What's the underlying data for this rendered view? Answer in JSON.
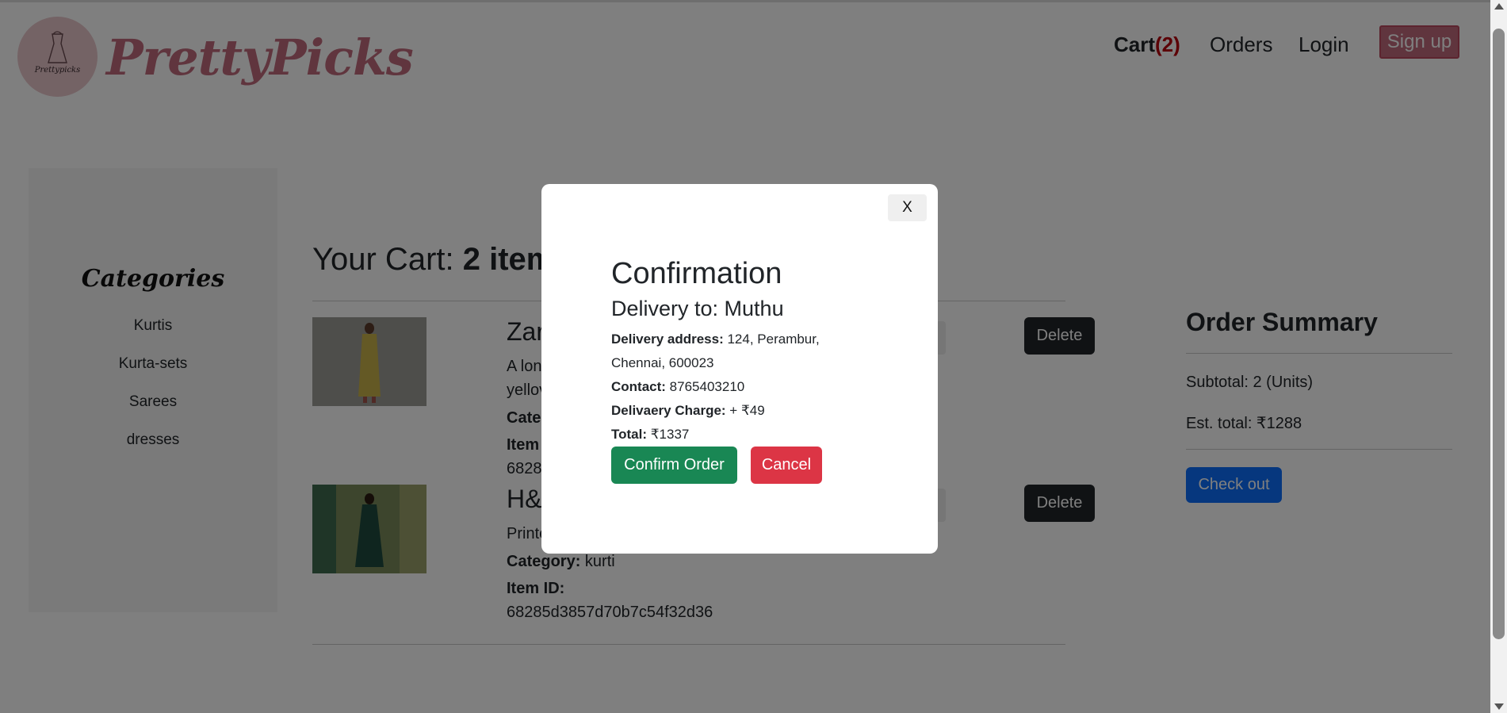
{
  "header": {
    "brand": "PrettyPicks",
    "logo_text": "Prettypicks",
    "nav": {
      "cart_label": "Cart",
      "cart_count": "(2)",
      "orders": "Orders",
      "login": "Login",
      "signup": "Sign up"
    }
  },
  "sidebar": {
    "title": "Categories",
    "items": [
      "Kurtis",
      "Kurta-sets",
      "Sarees",
      "dresses"
    ]
  },
  "cart": {
    "heading_prefix": "Your Cart: ",
    "heading_count": "2 item",
    "items": [
      {
        "name_visible": "Zar",
        "desc_line1": "A lon",
        "desc_line2": "yellov",
        "category_label": "Categ",
        "itemid_label": "Item",
        "itemid_value": "6828",
        "delete_label": "Delete"
      },
      {
        "name_visible": "H&",
        "desc_line1": "Printe",
        "category_label": "Category:",
        "category_value": " kurti",
        "itemid_label": "Item ID:",
        "itemid_value": "68285d3857d70b7c54f32d36",
        "delete_label": "Delete"
      }
    ]
  },
  "summary": {
    "title": "Order Summary",
    "subtotal": "Subtotal: 2 (Units)",
    "est_total": "Est. total: ₹1288",
    "checkout": "Check out"
  },
  "modal": {
    "close": "X",
    "title": "Confirmation",
    "delivery_to": "Delivery to: Muthu",
    "address_label": "Delivery address:",
    "address_line1": " 124, Perambur,",
    "address_line2": "Chennai, 600023",
    "contact_label": "Contact:",
    "contact_value": " 8765403210",
    "charge_label": "Delivaery Charge:",
    "charge_value": " + ₹49",
    "total_label": "Total:",
    "total_value": " ₹1337",
    "confirm": "Confirm Order",
    "cancel": "Cancel"
  },
  "colors": {
    "brand": "#c06b7c",
    "cart_count": "#b8000d",
    "confirm": "#198754",
    "cancel": "#dc3545",
    "checkout": "#0d6efd",
    "delete": "#212529"
  }
}
